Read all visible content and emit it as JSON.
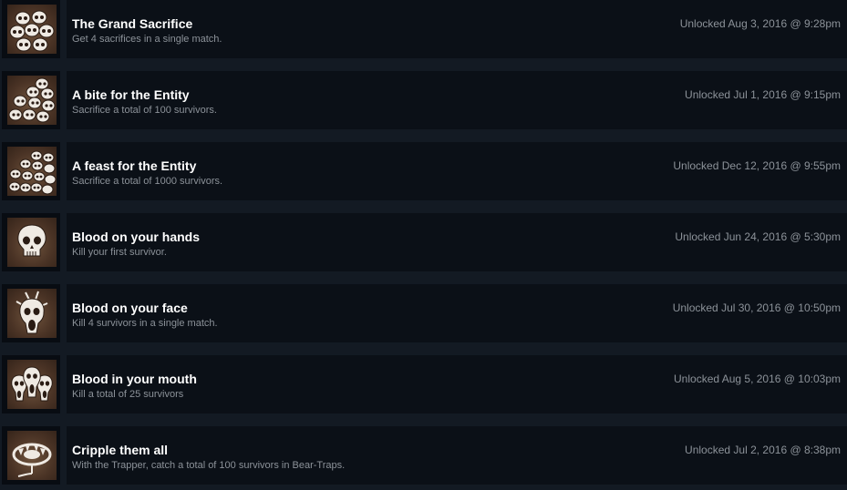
{
  "achievements": [
    {
      "title": "The Grand Sacrifice",
      "description": "Get 4 sacrifices in a single match.",
      "unlocked": "Unlocked Aug 3, 2016 @ 9:28pm",
      "icon": "skull-pile-icon"
    },
    {
      "title": "A bite for the Entity",
      "description": "Sacrifice a total of 100 survivors.",
      "unlocked": "Unlocked Jul 1, 2016 @ 9:15pm",
      "icon": "skull-heap-icon"
    },
    {
      "title": "A feast for the Entity",
      "description": "Sacrifice a total of 1000 survivors.",
      "unlocked": "Unlocked Dec 12, 2016 @ 9:55pm",
      "icon": "skull-mound-icon"
    },
    {
      "title": "Blood on your hands",
      "description": "Kill your first survivor.",
      "unlocked": "Unlocked Jun 24, 2016 @ 5:30pm",
      "icon": "skull-icon"
    },
    {
      "title": "Blood on your face",
      "description": "Kill 4 survivors in a single match.",
      "unlocked": "Unlocked Jul 30, 2016 @ 10:50pm",
      "icon": "screaming-skull-icon"
    },
    {
      "title": "Blood in your mouth",
      "description": "Kill a total of 25 survivors",
      "unlocked": "Unlocked Aug 5, 2016 @ 10:03pm",
      "icon": "screaming-skulls-icon"
    },
    {
      "title": "Cripple them all",
      "description": "With the Trapper, catch a total of 100 survivors in Bear-Traps.",
      "unlocked": "Unlocked Jul 2, 2016 @ 8:38pm",
      "icon": "bear-trap-icon"
    }
  ],
  "colors": {
    "background": "#131a23",
    "panel": "#0b1017",
    "title": "#ffffff",
    "muted": "#8c9299",
    "icon_bg": "#4a3325"
  }
}
